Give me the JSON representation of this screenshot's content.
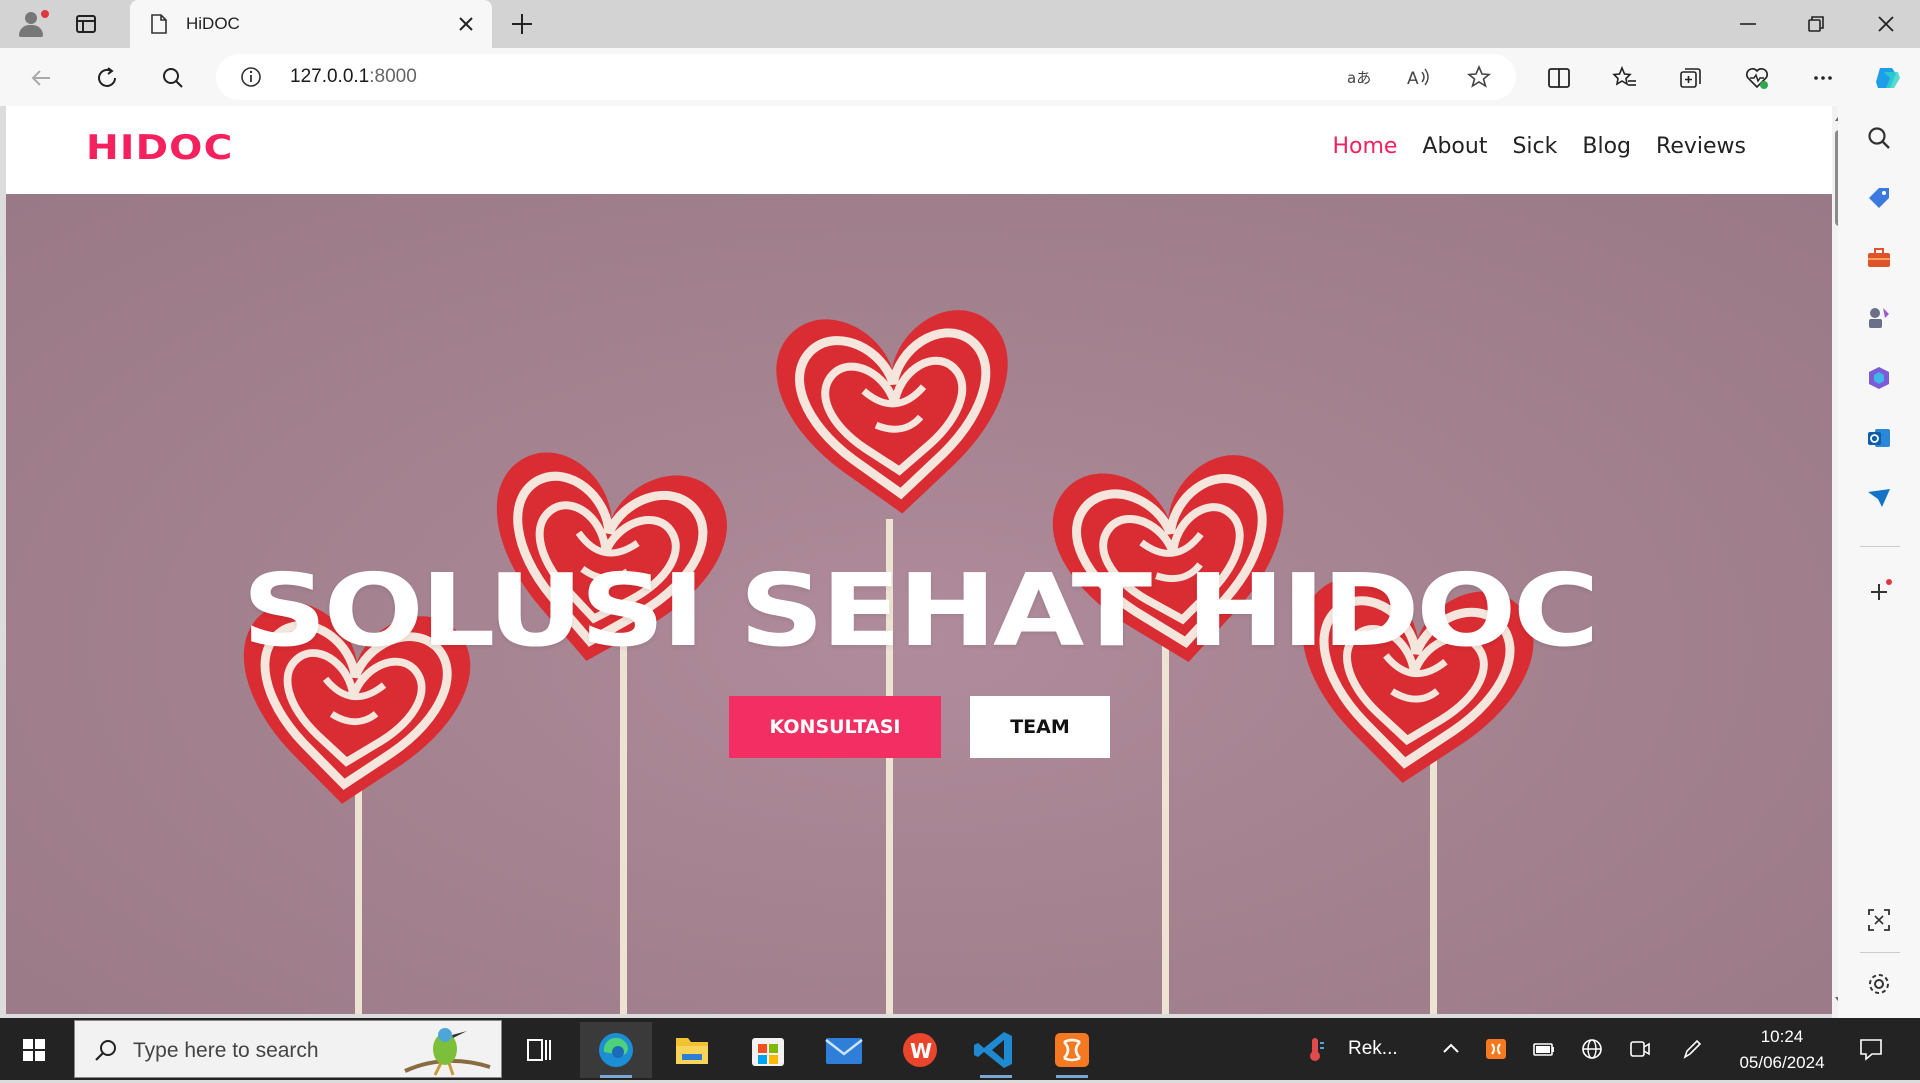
{
  "browser": {
    "tab": {
      "title": "HiDOC",
      "icon": "page-icon"
    },
    "address": {
      "url_host": "127.0.0.1",
      "url_port": ":8000",
      "info_icon": "info-icon"
    },
    "toolbar_icons": [
      "back-icon",
      "refresh-icon",
      "search-icon",
      "translate-icon",
      "read-aloud-icon",
      "favorite-star-icon",
      "split-screen-icon",
      "favorites-icon",
      "collections-icon",
      "browser-essentials-icon",
      "more-icon",
      "copilot-icon"
    ],
    "sidebar_icons": [
      "search-icon",
      "shopping-icon",
      "tools-icon",
      "games-icon",
      "microsoft-365-icon",
      "outlook-icon",
      "send-icon",
      "add-icon",
      "screenshot-icon",
      "settings-icon"
    ]
  },
  "site": {
    "logo": "HIDOC",
    "nav": [
      {
        "label": "Home",
        "active": true
      },
      {
        "label": "About",
        "active": false
      },
      {
        "label": "Sick",
        "active": false
      },
      {
        "label": "Blog",
        "active": false
      },
      {
        "label": "Reviews",
        "active": false
      }
    ],
    "hero": {
      "title": "SOLUSI SEHAT HIDOC",
      "primary_button": "KONSULTASI",
      "secondary_button": "TEAM"
    },
    "colors": {
      "accent": "#f5215e",
      "hero_background": "#a4828f",
      "button_primary": "#f22e62"
    }
  },
  "taskbar": {
    "search_placeholder": "Type here to search",
    "apps": [
      "task-view-icon",
      "edge-icon",
      "file-explorer-icon",
      "microsoft-store-icon",
      "mail-icon",
      "wps-office-icon",
      "vscode-icon",
      "xampp-icon"
    ],
    "weather_text": "Rek...",
    "time": "10:24",
    "date": "05/06/2024"
  }
}
